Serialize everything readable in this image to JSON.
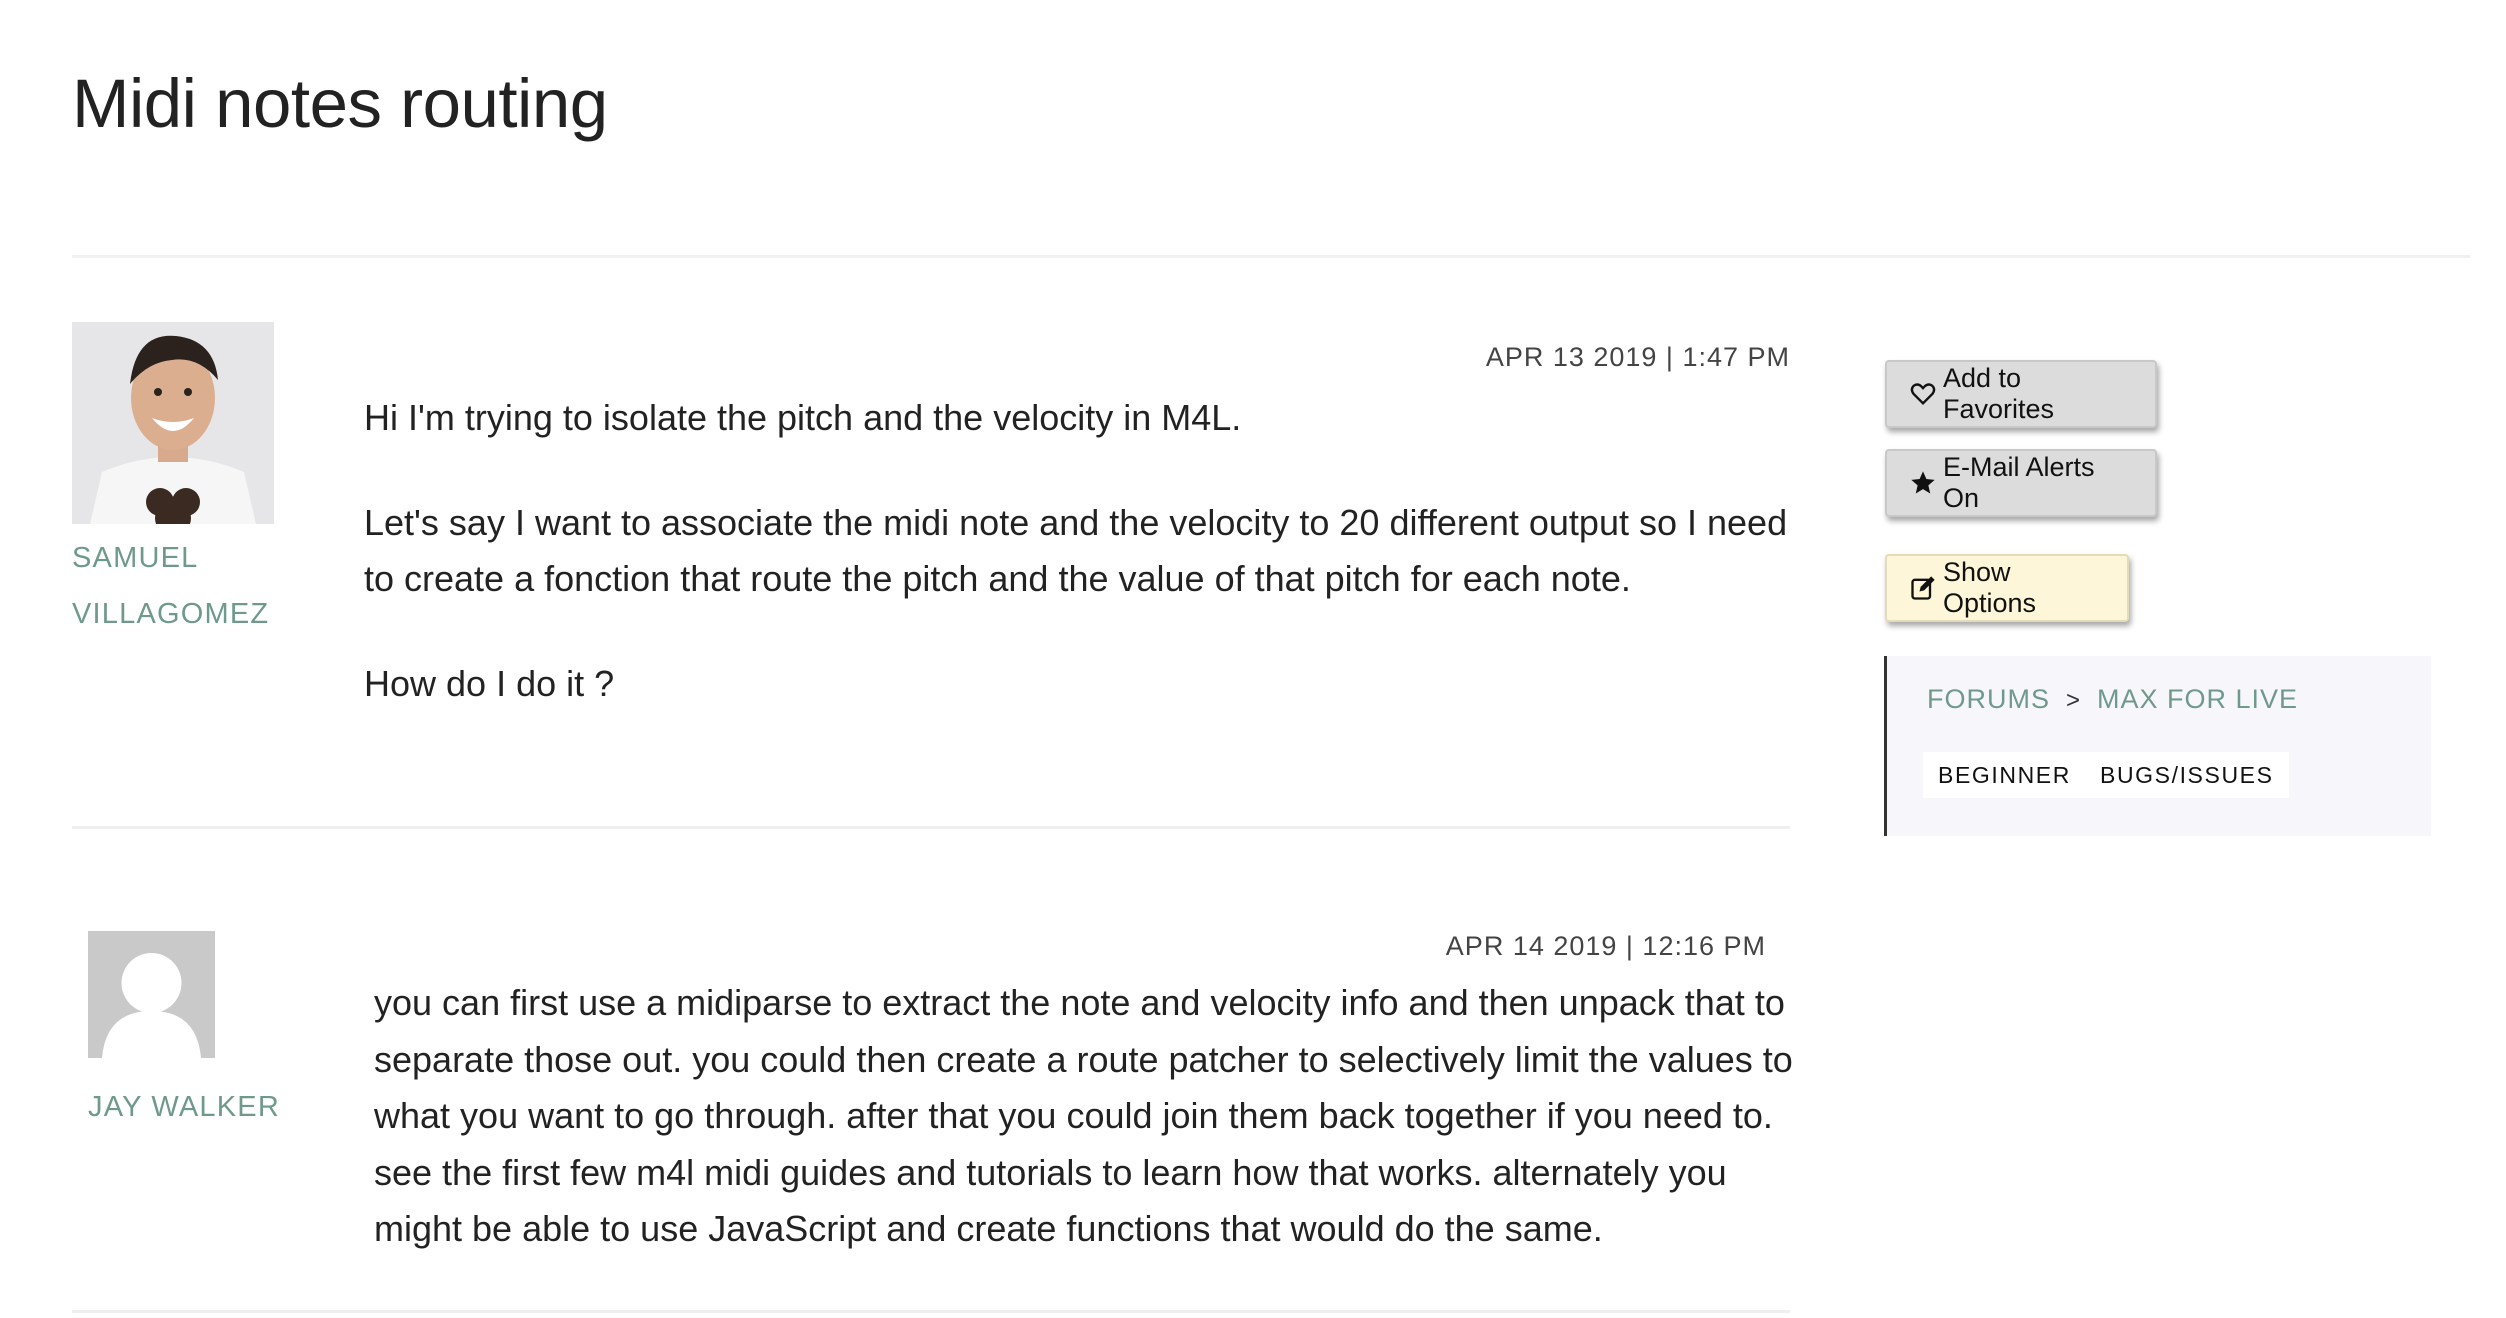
{
  "page": {
    "title": "Midi notes routing"
  },
  "posts": [
    {
      "author_line1": "SAMUEL",
      "author_line2": "VILLAGOMEZ",
      "timestamp": "APR 13 2019 | 1:47 PM",
      "paragraphs": [
        "Hi I'm trying to isolate the pitch and the velocity in M4L.",
        "Let's say I want  to associate the midi note and the velocity to 20 different output so I need to create a fonction that route the pitch and the value of that pitch for each note.",
        "How do I do it ?"
      ]
    },
    {
      "author": "JAY WALKER",
      "timestamp": "APR 14 2019 | 12:16 PM",
      "paragraphs": [
        "you can first use a midiparse to extract the note and velocity info and then unpack that to separate those out. you could then create a route patcher to selectively limit the values to what you want to go through.  after that you could join them back together if you need to. see the first few m4l midi guides and tutorials to learn how that works. alternately you might be able to use JavaScript and create functions that would do the same."
      ]
    }
  ],
  "sidebar": {
    "favorites_label": "Add to Favorites",
    "alerts_label": "E-Mail Alerts On",
    "options_label": "Show Options",
    "breadcrumb": {
      "root": "FORUMS",
      "separator": ">",
      "forum": "MAX FOR LIVE"
    },
    "tags": [
      "BEGINNER",
      "BUGS/ISSUES"
    ]
  },
  "colors": {
    "link": "#6f9a8b",
    "options_button": "#fdf6d8",
    "sidebar_box": "#f7f6fb"
  },
  "icons": [
    "heart-icon",
    "star-icon",
    "edit-icon"
  ]
}
